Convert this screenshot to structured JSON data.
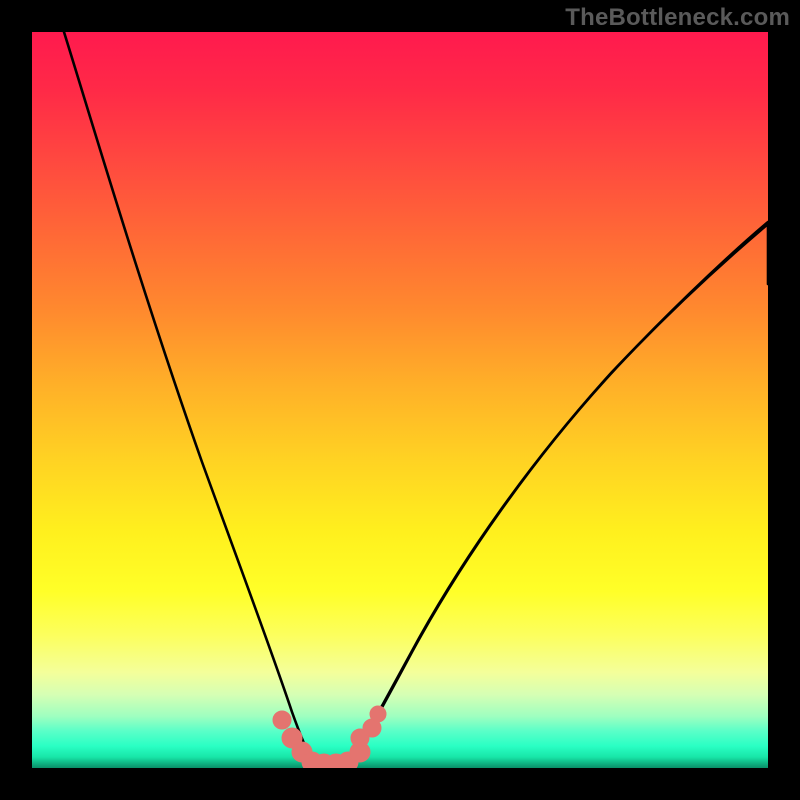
{
  "watermark": "TheBottleneck.com",
  "chart_data": {
    "type": "line",
    "title": "",
    "xlabel": "",
    "ylabel": "",
    "xlim": [
      0,
      100
    ],
    "ylim": [
      0,
      100
    ],
    "grid": false,
    "legend": false,
    "series": [
      {
        "name": "left-curve",
        "color": "#000000",
        "x": [
          4,
          8,
          12,
          16,
          20,
          24,
          28,
          31,
          33,
          35,
          37,
          38
        ],
        "y": [
          100,
          84,
          68,
          53,
          40,
          28,
          17,
          10,
          6,
          3,
          1,
          0
        ]
      },
      {
        "name": "right-curve",
        "color": "#000000",
        "x": [
          42,
          44,
          46,
          49,
          53,
          58,
          64,
          71,
          79,
          88,
          98,
          100
        ],
        "y": [
          0,
          1,
          3,
          7,
          13,
          20,
          28,
          37,
          46,
          55,
          64,
          66
        ]
      },
      {
        "name": "bottom-marker-band",
        "color": "#e4746f",
        "description": "Rounded marker strip at valley bottom spanning from the end of left curve to the start of right curve",
        "x": [
          33,
          35,
          37,
          38,
          39,
          40,
          41,
          42,
          44,
          46
        ],
        "y": [
          6,
          3,
          1,
          0,
          0,
          0,
          0,
          0,
          2,
          4
        ]
      }
    ],
    "gradient_stops": [
      {
        "pos": 0.0,
        "color": "#ff1a4e"
      },
      {
        "pos": 0.18,
        "color": "#ff4a3f"
      },
      {
        "pos": 0.38,
        "color": "#ff8a2e"
      },
      {
        "pos": 0.58,
        "color": "#ffd223"
      },
      {
        "pos": 0.76,
        "color": "#ffff28"
      },
      {
        "pos": 0.9,
        "color": "#d6ffb4"
      },
      {
        "pos": 0.97,
        "color": "#2affc4"
      },
      {
        "pos": 1.0,
        "color": "#0a8f68"
      }
    ]
  }
}
